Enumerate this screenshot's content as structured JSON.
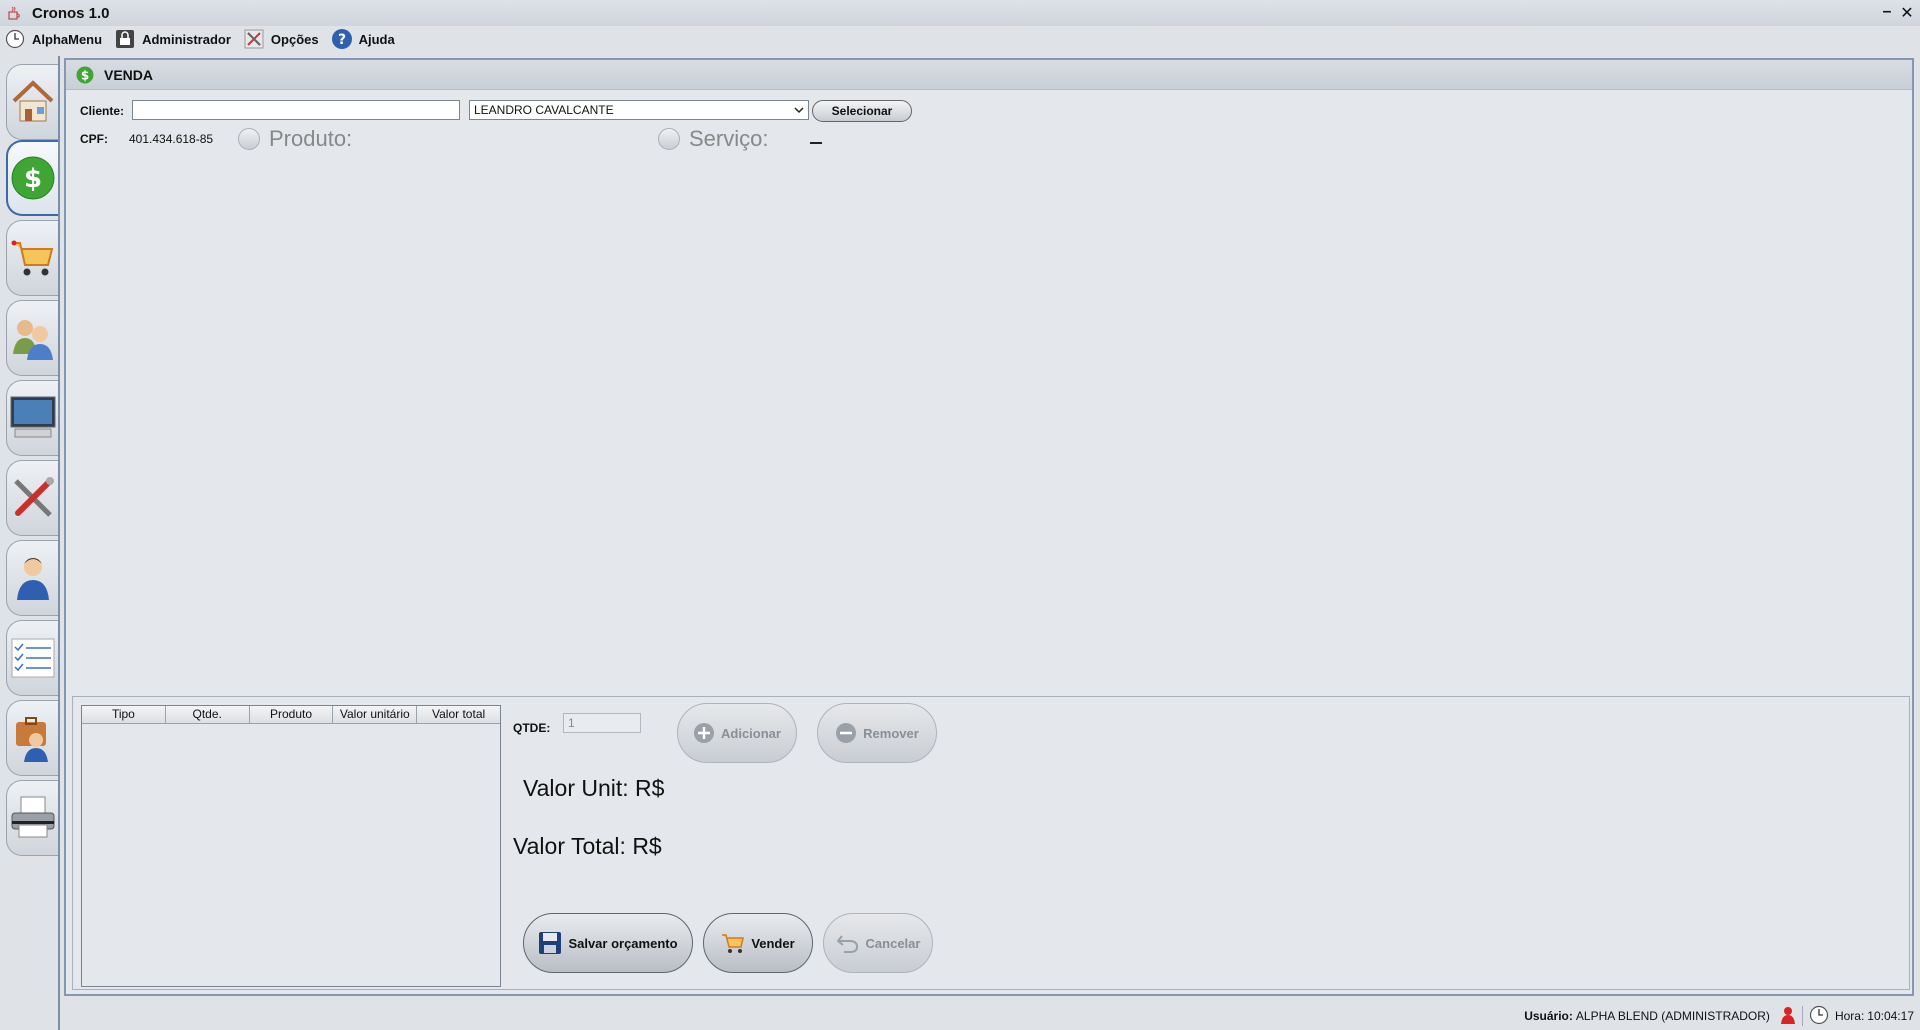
{
  "window": {
    "title": "Cronos 1.0",
    "minimize_glyph": "–",
    "close_glyph": "✕"
  },
  "menu": {
    "items": [
      {
        "label": "AlphaMenu",
        "icon": "clock-icon"
      },
      {
        "label": "Administrador",
        "icon": "lock-icon"
      },
      {
        "label": "Opções",
        "icon": "tools-icon"
      },
      {
        "label": "Ajuda",
        "icon": "help-icon"
      }
    ]
  },
  "sidebar": {
    "items": [
      {
        "icon": "home-icon"
      },
      {
        "icon": "dollar-icon",
        "active": true
      },
      {
        "icon": "cart-icon"
      },
      {
        "icon": "users-icon"
      },
      {
        "icon": "monitor-icon"
      },
      {
        "icon": "tools-icon"
      },
      {
        "icon": "person-icon"
      },
      {
        "icon": "checklist-icon"
      },
      {
        "icon": "briefcase-person-icon"
      },
      {
        "icon": "printer-icon"
      }
    ]
  },
  "venda": {
    "title": "VENDA",
    "cliente_label": "Cliente:",
    "cliente_value": "",
    "cliente_selected": "LEANDRO CAVALCANTE",
    "selecionar_label": "Selecionar",
    "cpf_label": "CPF:",
    "cpf_value": "401.434.618-85",
    "produto_label": "Produto:",
    "servico_label": "Serviço:"
  },
  "table": {
    "columns": [
      "Tipo",
      "Qtde.",
      "Produto",
      "Valor unitário",
      "Valor total"
    ],
    "rows": []
  },
  "controls": {
    "qtde_label": "QTDE:",
    "qtde_value": "1",
    "adicionar_label": "Adicionar",
    "remover_label": "Remover",
    "valor_unit_label": "Valor Unit: R$",
    "valor_total_label": "Valor Total: R$",
    "salvar_label": "Salvar orçamento",
    "vender_label": "Vender",
    "cancelar_label": "Cancelar"
  },
  "status": {
    "usuario_label": "Usuário:",
    "usuario_value": "ALPHA BLEND (ADMINISTRADOR)",
    "hora_label": "Hora:",
    "hora_value": "10:04:17"
  },
  "colors": {
    "accent_blue": "#3c6aa8",
    "dollar_green": "#3fa535",
    "background": "#dfe3e8"
  }
}
